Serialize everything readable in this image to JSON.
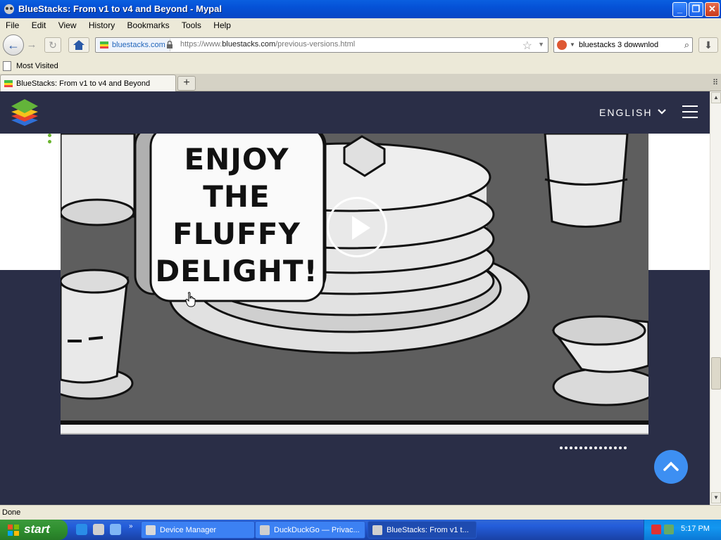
{
  "window": {
    "title": "BlueStacks: From v1 to v4 and Beyond - Mypal",
    "minimize": "_",
    "maximize": "❐",
    "close": "✕"
  },
  "menu": [
    "File",
    "Edit",
    "View",
    "History",
    "Bookmarks",
    "Tools",
    "Help"
  ],
  "navbar": {
    "back": "←",
    "forward": "→",
    "reload": "↻",
    "site_identity": "bluestacks.com",
    "url_prefix": "https://www.",
    "url_domain": "bluestacks.com",
    "url_path": "/previous-versions.html",
    "bookmark_star": "☆",
    "url_dropdown": "▼",
    "search_value": "bluestacks 3 dowwnlod",
    "search_drop": "▼",
    "search_go": "⌕",
    "download": "⬇"
  },
  "bookmarks": {
    "label": "Most Visited"
  },
  "tabs": {
    "active_title": "BlueStacks: From v1 to v4 and Beyond",
    "new_tab": "+",
    "list": "⠿"
  },
  "page": {
    "language": "ENGLISH",
    "video_caption": [
      "ENJOY",
      "THE",
      "FLUFFY",
      "DELIGHT!"
    ],
    "carousel_dot_count": 14,
    "colors": {
      "header": "#2a2e47",
      "accent": "#3d8ff2",
      "green": "#6ab42e"
    }
  },
  "scrollbar": {
    "up": "▲",
    "down": "▼"
  },
  "status": {
    "text": "Done"
  },
  "taskbar": {
    "start": "start",
    "quick_chevron": "»",
    "tasks": [
      "Device Manager",
      "DuckDuckGo — Privac...",
      "BlueStacks: From v1 t..."
    ],
    "clock": "5:17 PM"
  }
}
